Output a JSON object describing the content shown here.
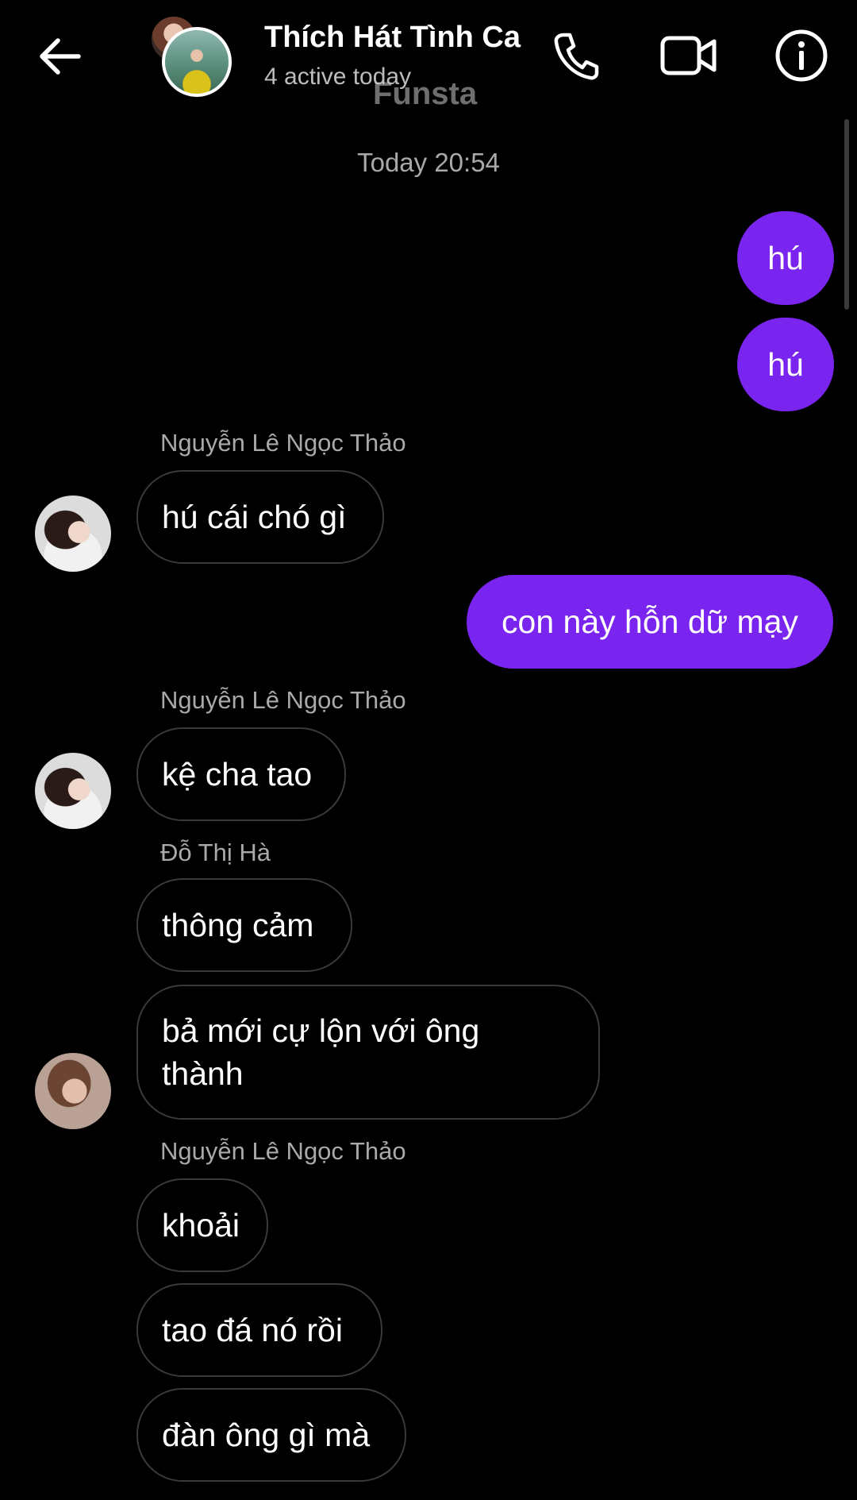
{
  "header": {
    "title": "Thích Hát Tình Ca",
    "subtitle": "4 active today",
    "watermark": "Funsta",
    "icons": {
      "back": "back-arrow-icon",
      "call": "phone-icon",
      "video": "video-camera-icon",
      "info": "info-icon"
    }
  },
  "conversation": {
    "timestamp": "Today 20:54",
    "messages": [
      {
        "type": "out",
        "text": "hú"
      },
      {
        "type": "out",
        "text": "hú"
      },
      {
        "type": "name",
        "text": "Nguyễn Lê Ngọc Thảo"
      },
      {
        "type": "in",
        "text": "hú cái chó gì"
      },
      {
        "type": "out",
        "text": "con này hỗn dữ mạy"
      },
      {
        "type": "name",
        "text": "Nguyễn Lê Ngọc Thảo"
      },
      {
        "type": "in",
        "text": "kệ cha tao"
      },
      {
        "type": "name",
        "text": "Đỗ Thị Hà"
      },
      {
        "type": "in",
        "text": "thông cảm"
      },
      {
        "type": "in",
        "text": "bả mới cự lộn với ông thành"
      },
      {
        "type": "name",
        "text": "Nguyễn Lê Ngọc Thảo"
      },
      {
        "type": "in",
        "text": "khoải"
      },
      {
        "type": "in",
        "text": "tao đá nó rồi"
      },
      {
        "type": "in",
        "text": "đàn ông gì mà"
      }
    ]
  },
  "colors": {
    "outgoing_bubble": "#7a24f0",
    "background": "#000000",
    "incoming_border": "#3a3a3a",
    "secondary_text": "#a9a9a9"
  }
}
